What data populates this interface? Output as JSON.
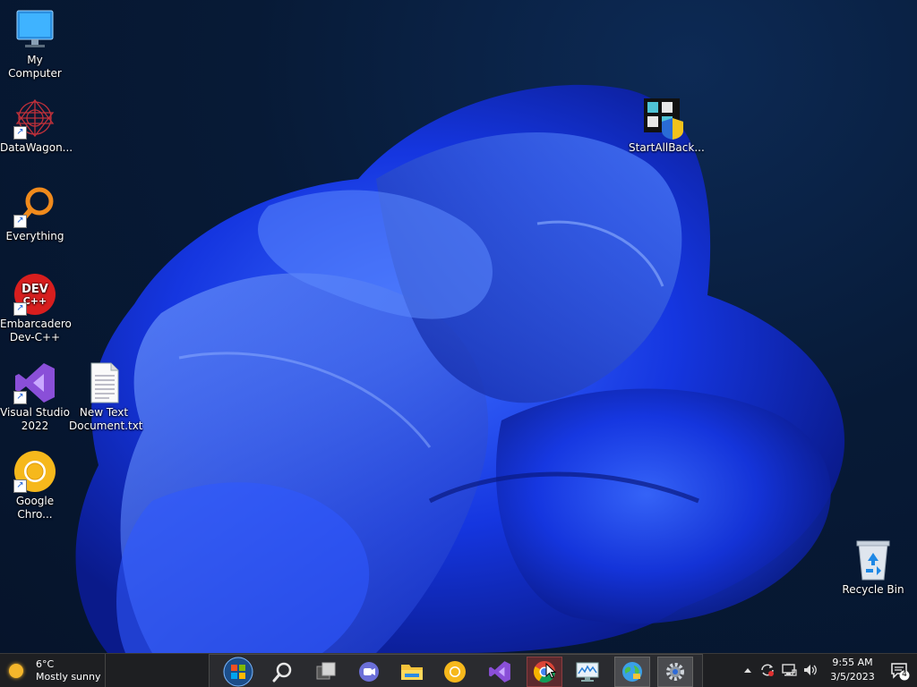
{
  "desktop_icons": [
    {
      "id": "my-computer",
      "label": "My Computer",
      "shortcut": false
    },
    {
      "id": "datawagon",
      "label": "DataWagon...",
      "shortcut": true
    },
    {
      "id": "everything",
      "label": "Everything",
      "shortcut": true
    },
    {
      "id": "devcpp",
      "label": "Embarcadero Dev-C++",
      "shortcut": true,
      "glyph_text": "DEV C++"
    },
    {
      "id": "visual-studio",
      "label": "Visual Studio 2022",
      "shortcut": true
    },
    {
      "id": "new-text",
      "label": "New Text Document.txt",
      "shortcut": false
    },
    {
      "id": "chrome",
      "label": "Google Chro...",
      "shortcut": true
    },
    {
      "id": "startallback",
      "label": "StartAllBack...",
      "shortcut": false
    },
    {
      "id": "recycle-bin",
      "label": "Recycle Bin",
      "shortcut": false
    }
  ],
  "taskbar": {
    "weather": {
      "temperature": "6°C",
      "condition": "Mostly sunny"
    },
    "apps": [
      {
        "name": "start-button",
        "icon": "windows-orb-icon"
      },
      {
        "name": "search-button",
        "icon": "search-icon"
      },
      {
        "name": "task-view-button",
        "icon": "task-view-icon"
      },
      {
        "name": "teams-chat-button",
        "icon": "chat-icon"
      },
      {
        "name": "file-explorer-button",
        "icon": "folder-icon"
      },
      {
        "name": "chrome-canary-button",
        "icon": "chrome-canary-icon"
      },
      {
        "name": "visual-studio-button",
        "icon": "visual-studio-icon"
      },
      {
        "name": "chrome-button",
        "icon": "chrome-icon",
        "active": true
      },
      {
        "name": "resource-monitor-button",
        "icon": "monitor-icon"
      },
      {
        "name": "control-panel-button",
        "icon": "globe-icon",
        "pinned": true
      },
      {
        "name": "settings-button",
        "icon": "gear-icon",
        "pinned": true
      }
    ],
    "tray": {
      "time": "9:55 AM",
      "date": "3/5/2023",
      "notification_count": "4"
    }
  },
  "colors": {
    "taskbar": "#1e1f22",
    "wallpaper_blue": "#1f4bff",
    "active_app": "#5c2a2e"
  }
}
